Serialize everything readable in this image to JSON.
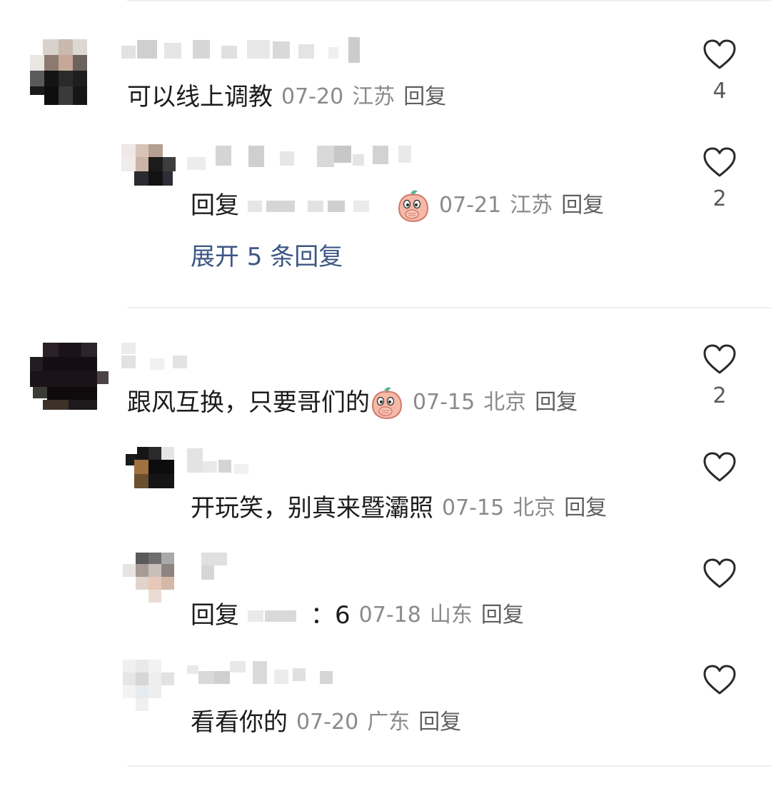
{
  "comments": [
    {
      "text": "可以线上调教",
      "date": "07-20",
      "location": "江苏",
      "reply_label": "回复",
      "likes": "4",
      "replies": [
        {
          "prefix": "回复",
          "date": "07-21",
          "location": "江苏",
          "reply_label": "回复",
          "likes": "2",
          "emoji": "peach-cover-mouth-emoji"
        }
      ],
      "expand_label": "展开 5 条回复"
    },
    {
      "text": "跟风互换，只要哥们的",
      "date": "07-15",
      "location": "北京",
      "reply_label": "回复",
      "likes": "2",
      "emoji": "peach-cover-mouth-emoji",
      "replies": [
        {
          "text": "开玩笑，别真来暨灞照",
          "date": "07-15",
          "location": "北京",
          "reply_label": "回复",
          "likes": ""
        },
        {
          "prefix": "回复",
          "suffix": "：6",
          "date": "07-18",
          "location": "山东",
          "reply_label": "回复",
          "likes": ""
        },
        {
          "text": "看看你的",
          "date": "07-20",
          "location": "广东",
          "reply_label": "回复",
          "likes": ""
        }
      ]
    }
  ],
  "icons": {
    "like": "heart-outline-icon"
  },
  "colors": {
    "link": "#3d5684",
    "meta": "#8a8a8a",
    "divider": "#efefef"
  }
}
